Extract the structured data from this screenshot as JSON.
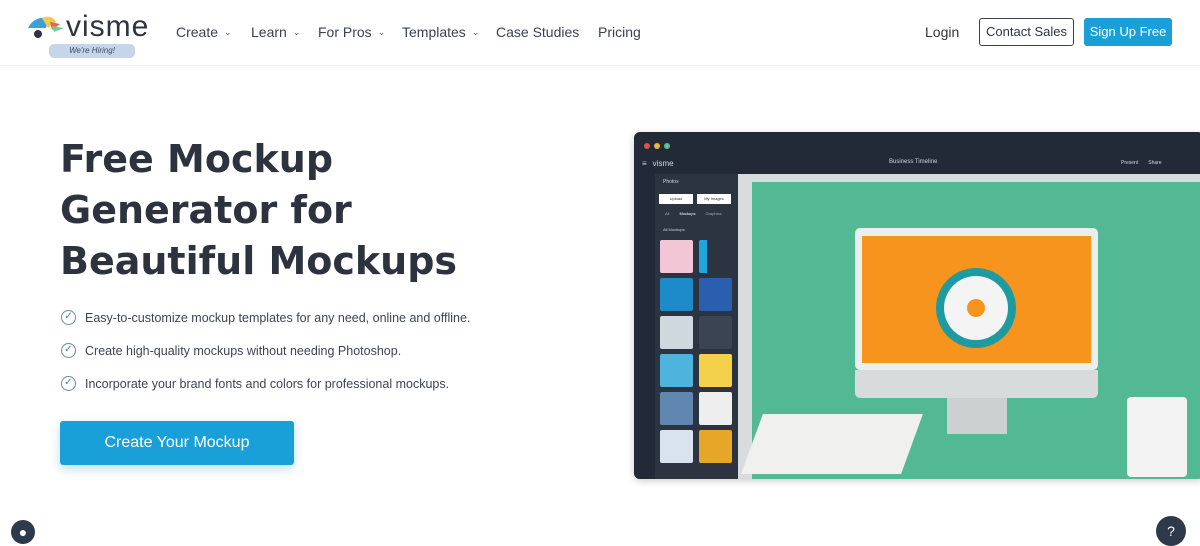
{
  "nav": {
    "logo": "visme",
    "hiring_badge": "We're Hiring!",
    "items": [
      {
        "label": "Create",
        "dropdown": true
      },
      {
        "label": "Learn",
        "dropdown": true
      },
      {
        "label": "For Pros",
        "dropdown": true
      },
      {
        "label": "Templates",
        "dropdown": true
      },
      {
        "label": "Case Studies",
        "dropdown": false
      },
      {
        "label": "Pricing",
        "dropdown": false
      }
    ],
    "login": "Login",
    "contact_sales": "Contact Sales",
    "sign_up": "Sign Up Free"
  },
  "hero": {
    "title": "Free Mockup Generator for Beautiful Mockups",
    "features": [
      "Easy-to-customize mockup templates for any need, online and offline.",
      "Create high-quality mockups without needing Photoshop.",
      "Incorporate your brand fonts and colors for professional mockups."
    ],
    "cta": "Create Your Mockup"
  },
  "mockup": {
    "app_logo": "visme",
    "doc_title": "Business Timeline",
    "panel_search": "Photos",
    "upload": "Upload",
    "my_images": "My Images",
    "tabs": [
      "All",
      "Mockups",
      "Graphics"
    ],
    "filter": "All Mockups",
    "present": "Present",
    "share": "Share"
  },
  "colors": {
    "accent": "#1aa0d8",
    "dark": "#232a37",
    "canvas_green": "#53b994",
    "screen_orange": "#f7941d"
  },
  "widgets": {
    "help": "?"
  }
}
